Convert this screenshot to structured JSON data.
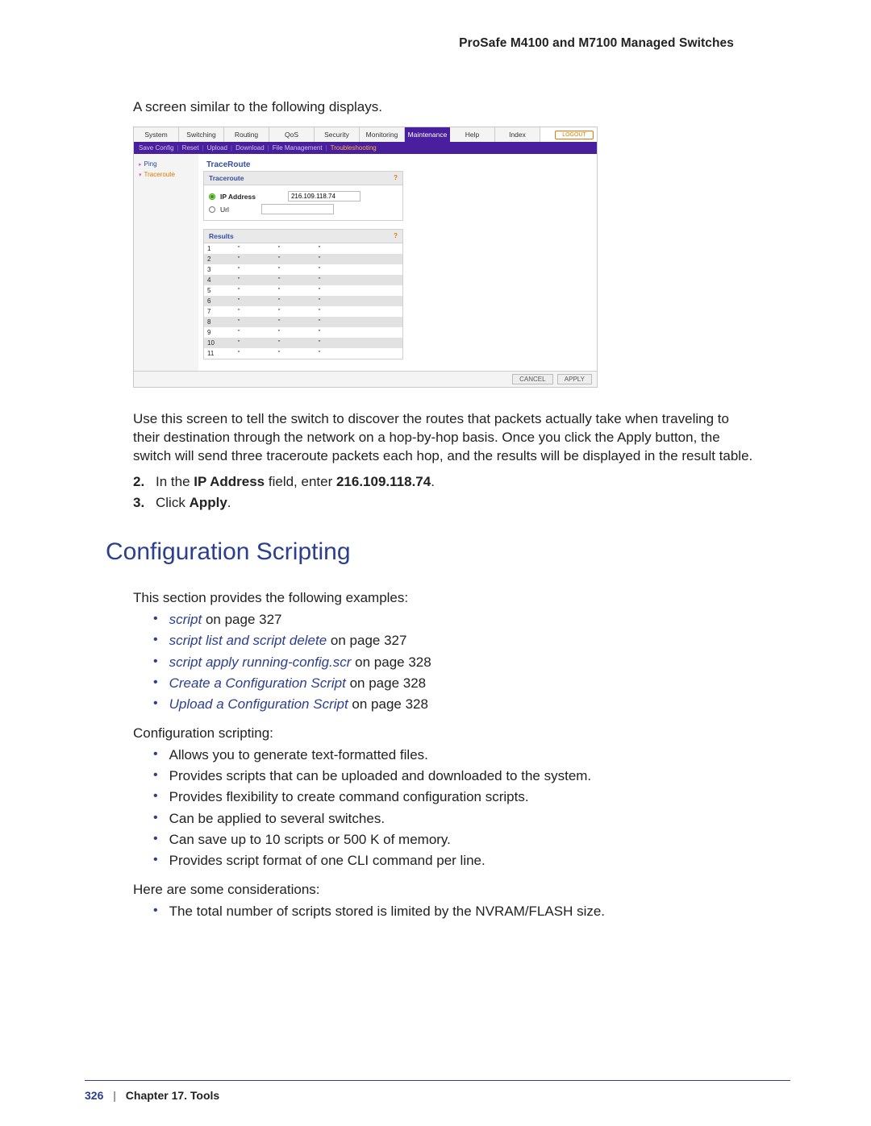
{
  "header": "ProSafe M4100 and M7100 Managed Switches",
  "intro": "A screen similar to the following displays.",
  "shot": {
    "tabs": [
      "System",
      "Switching",
      "Routing",
      "QoS",
      "Security",
      "Monitoring",
      "Maintenance",
      "Help",
      "Index"
    ],
    "active_tab": 6,
    "logout": "LOGOUT",
    "subnav": [
      "Save Config",
      "Reset",
      "Upload",
      "Download",
      "File Management",
      "Troubleshooting"
    ],
    "subnav_active": 5,
    "sidemenu": [
      {
        "label": "Ping",
        "active": false
      },
      {
        "label": "Traceroute",
        "active": true
      }
    ],
    "section_title": "TraceRoute",
    "box1": {
      "title": "Traceroute",
      "ip_label": "IP Address",
      "url_label": "Url",
      "ip_value": "216.109.118.74"
    },
    "box2": {
      "title": "Results",
      "rows": [
        "1",
        "2",
        "3",
        "4",
        "5",
        "6",
        "7",
        "8",
        "9",
        "10",
        "11"
      ],
      "placeholder": "\""
    },
    "buttons": {
      "cancel": "CANCEL",
      "apply": "APPLY"
    }
  },
  "para1": "Use this screen to tell the switch to discover the routes that packets actually take when traveling to their destination through the network on a hop-by-hop basis. Once you click the Apply button, the switch will send three traceroute packets each hop, and the results will be displayed in the result table.",
  "step2_num": "2.",
  "step2_a": "In the ",
  "step2_b": "IP Address",
  "step2_c": " field, enter ",
  "step2_d": "216.109.118.74",
  "step2_e": ".",
  "step3_num": "3.",
  "step3_a": "Click ",
  "step3_b": "Apply",
  "step3_c": ".",
  "h1": "Configuration Scripting",
  "examples_intro": "This section provides the following examples:",
  "ex": [
    {
      "link": "script",
      "tail": " on page 327"
    },
    {
      "link": "script list and script delete",
      "tail": " on page 327"
    },
    {
      "link": "script apply running-config.scr",
      "tail": " on page 328"
    },
    {
      "link": "Create a Configuration Script",
      "tail": " on page 328"
    },
    {
      "link": "Upload a Configuration Script",
      "tail": " on page 328"
    }
  ],
  "conf_label": "Configuration scripting:",
  "conf": [
    "Allows you to generate text-formatted files.",
    "Provides scripts that can be uploaded and downloaded to the system.",
    "Provides flexibility to create command configuration scripts.",
    "Can be applied to several switches.",
    "Can save up to 10 scripts or 500 K of memory.",
    "Provides script format of one CLI command per line."
  ],
  "consid_label": "Here are some considerations:",
  "consid": [
    "The total number of scripts stored is limited by the NVRAM/FLASH size."
  ],
  "footer": {
    "page": "326",
    "sep": "|",
    "chapter": "Chapter 17.  Tools"
  }
}
